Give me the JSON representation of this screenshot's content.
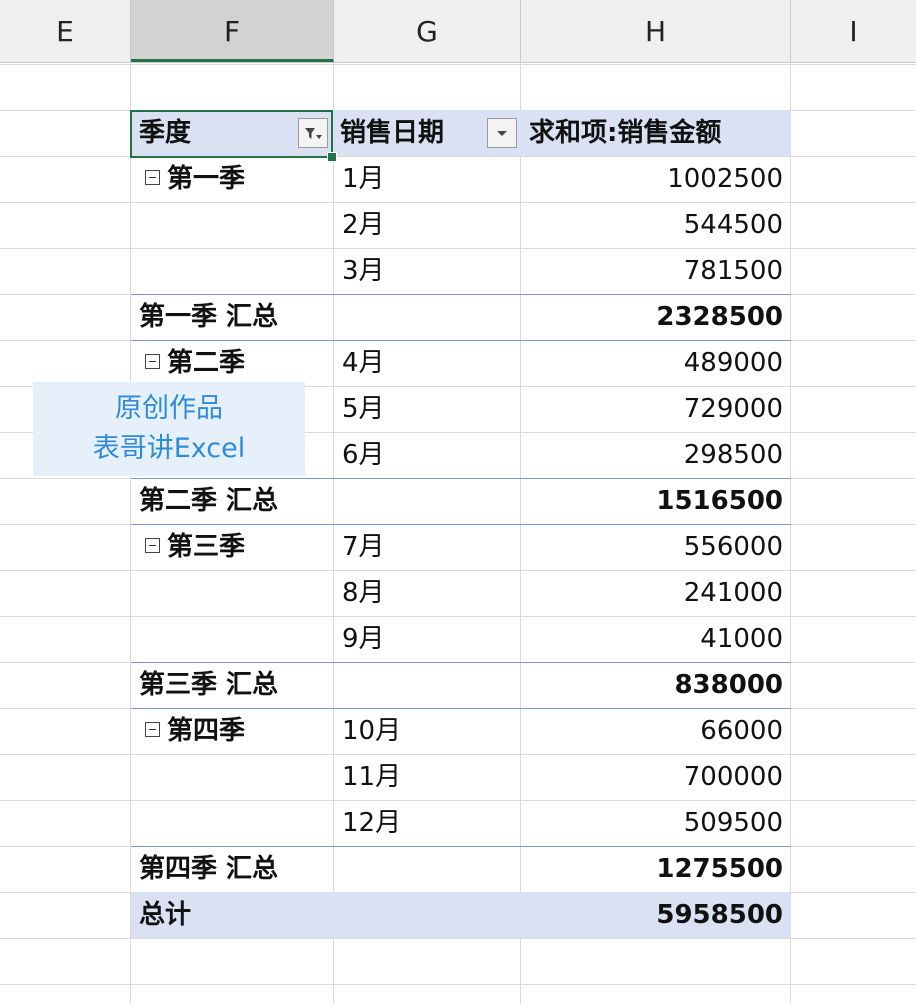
{
  "columns": [
    "E",
    "F",
    "G",
    "H",
    "I"
  ],
  "selected_column": "F",
  "pivot": {
    "headers": {
      "row_field": "季度",
      "col_field": "销售日期",
      "value_field": "求和项:销售金额"
    },
    "groups": [
      {
        "name": "第一季",
        "months": [
          {
            "month": "1月",
            "value": "1002500"
          },
          {
            "month": "2月",
            "value": "544500"
          },
          {
            "month": "3月",
            "value": "781500"
          }
        ],
        "subtotal_label": "第一季 汇总",
        "subtotal": "2328500"
      },
      {
        "name": "第二季",
        "months": [
          {
            "month": "4月",
            "value": "489000"
          },
          {
            "month": "5月",
            "value": "729000"
          },
          {
            "month": "6月",
            "value": "298500"
          }
        ],
        "subtotal_label": "第二季 汇总",
        "subtotal": "1516500"
      },
      {
        "name": "第三季",
        "months": [
          {
            "month": "7月",
            "value": "556000"
          },
          {
            "month": "8月",
            "value": "241000"
          },
          {
            "month": "9月",
            "value": "41000"
          }
        ],
        "subtotal_label": "第三季 汇总",
        "subtotal": "838000"
      },
      {
        "name": "第四季",
        "months": [
          {
            "month": "10月",
            "value": "66000"
          },
          {
            "month": "11月",
            "value": "700000"
          },
          {
            "month": "12月",
            "value": "509500"
          }
        ],
        "subtotal_label": "第四季 汇总",
        "subtotal": "1275500"
      }
    ],
    "grand_total_label": "总计",
    "grand_total": "5958500"
  },
  "watermark": {
    "line1": "原创作品",
    "line2": "表哥讲Excel"
  },
  "icons": {
    "row_filter": "filter-dropdown-icon",
    "col_filter": "dropdown-arrow-icon",
    "collapse": "collapse-minus-icon"
  },
  "colors": {
    "header_band": "#d9e1f2",
    "selection": "#217346",
    "watermark_text": "#2f8bd8"
  }
}
